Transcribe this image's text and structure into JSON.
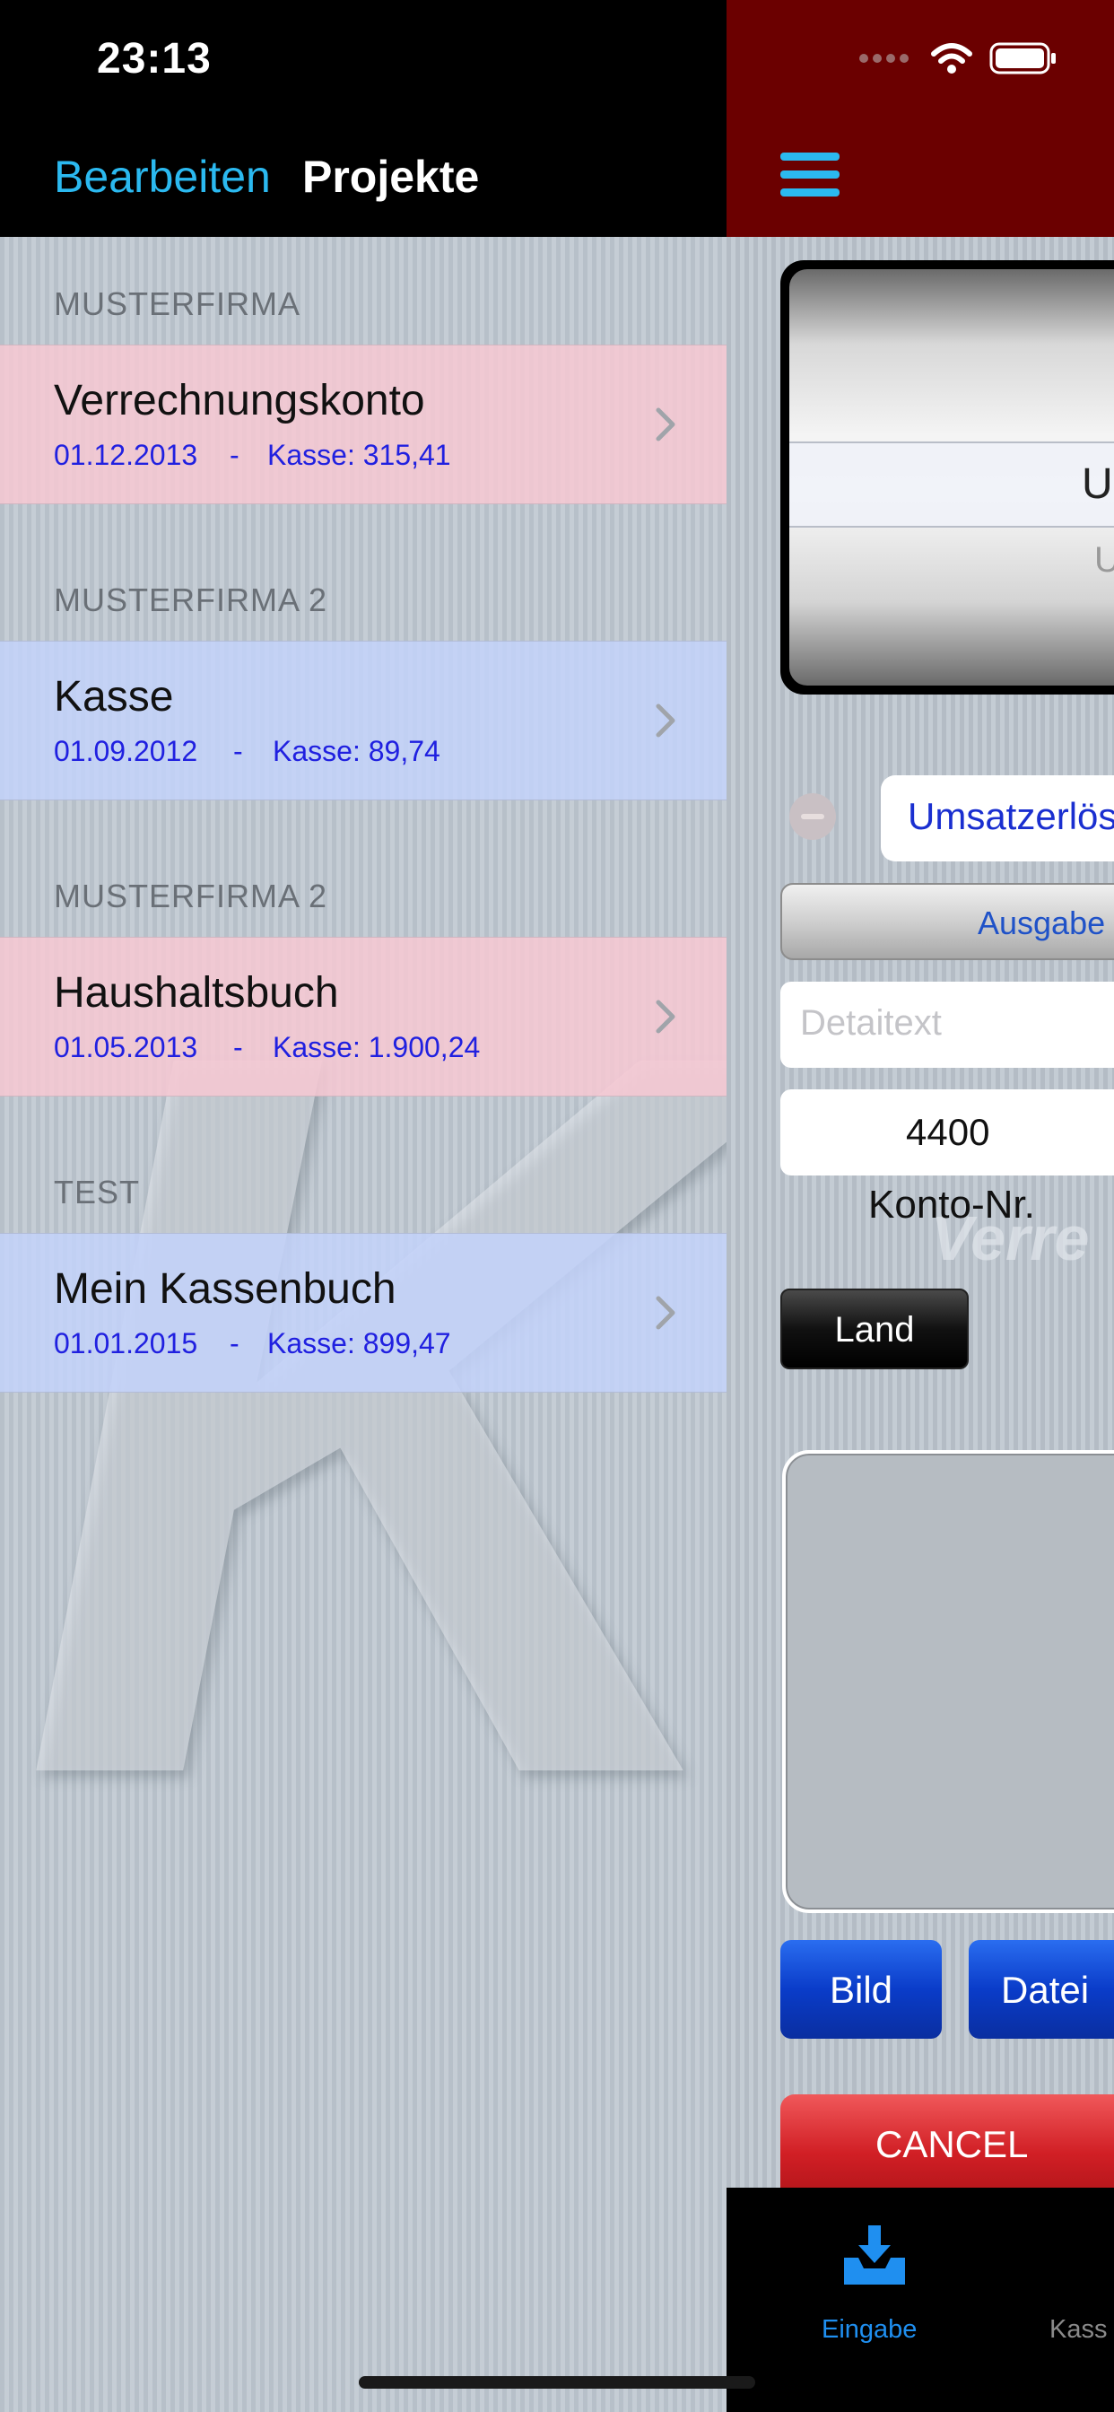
{
  "status_bar": {
    "time": "23:13"
  },
  "nav": {
    "edit_label": "Bearbeiten",
    "title": "Projekte"
  },
  "sections": [
    {
      "header": "MUSTERFIRMA",
      "row": {
        "name": "Verrechnungskonto",
        "date": "01.12.2013",
        "separator": "-",
        "kasse": "Kasse: 315,41",
        "color": "#f7c8d2"
      }
    },
    {
      "header": "MUSTERFIRMA 2",
      "row": {
        "name": "Kasse",
        "date": "01.09.2012",
        "separator": "-",
        "kasse": "Kasse: 89,74",
        "color": "#c3d2fa"
      }
    },
    {
      "header": "MUSTERFIRMA 2",
      "row": {
        "name": "Haushaltsbuch",
        "date": "01.05.2013",
        "separator": "-",
        "kasse": "Kasse: 1.900,24",
        "color": "#f7c8d2"
      }
    },
    {
      "header": "TEST",
      "row": {
        "name": "Mein Kassenbuch",
        "date": "01.01.2015",
        "separator": "-",
        "kasse": "Kasse: 899,47",
        "color": "#c3d2fa"
      }
    }
  ],
  "entry_form": {
    "menu_icon": "hamburger-icon",
    "picker": {
      "selected": "U",
      "next": "U"
    },
    "remove_icon": "minus-circle-icon",
    "category": "Umsatzerlös",
    "type_button": "Ausgabe",
    "detail_placeholder": "Detaitext",
    "konto_value": "4400",
    "konto_label": "Konto-Nr.",
    "faint_background_text": "Verre",
    "land_button": "Land",
    "bild_button": "Bild",
    "datei_button": "Datei",
    "cancel_button": "CANCEL"
  },
  "tab_bar": {
    "tabs": [
      {
        "label": "Eingabe",
        "icon": "inbox-download-icon",
        "active": true
      },
      {
        "label": "Kass",
        "icon": "book-icon",
        "active": false
      }
    ]
  },
  "colors": {
    "accent": "#2bb9f0",
    "right_header": "#6b0000",
    "link_blue": "#2020e0",
    "tab_active": "#1f8ff0"
  }
}
